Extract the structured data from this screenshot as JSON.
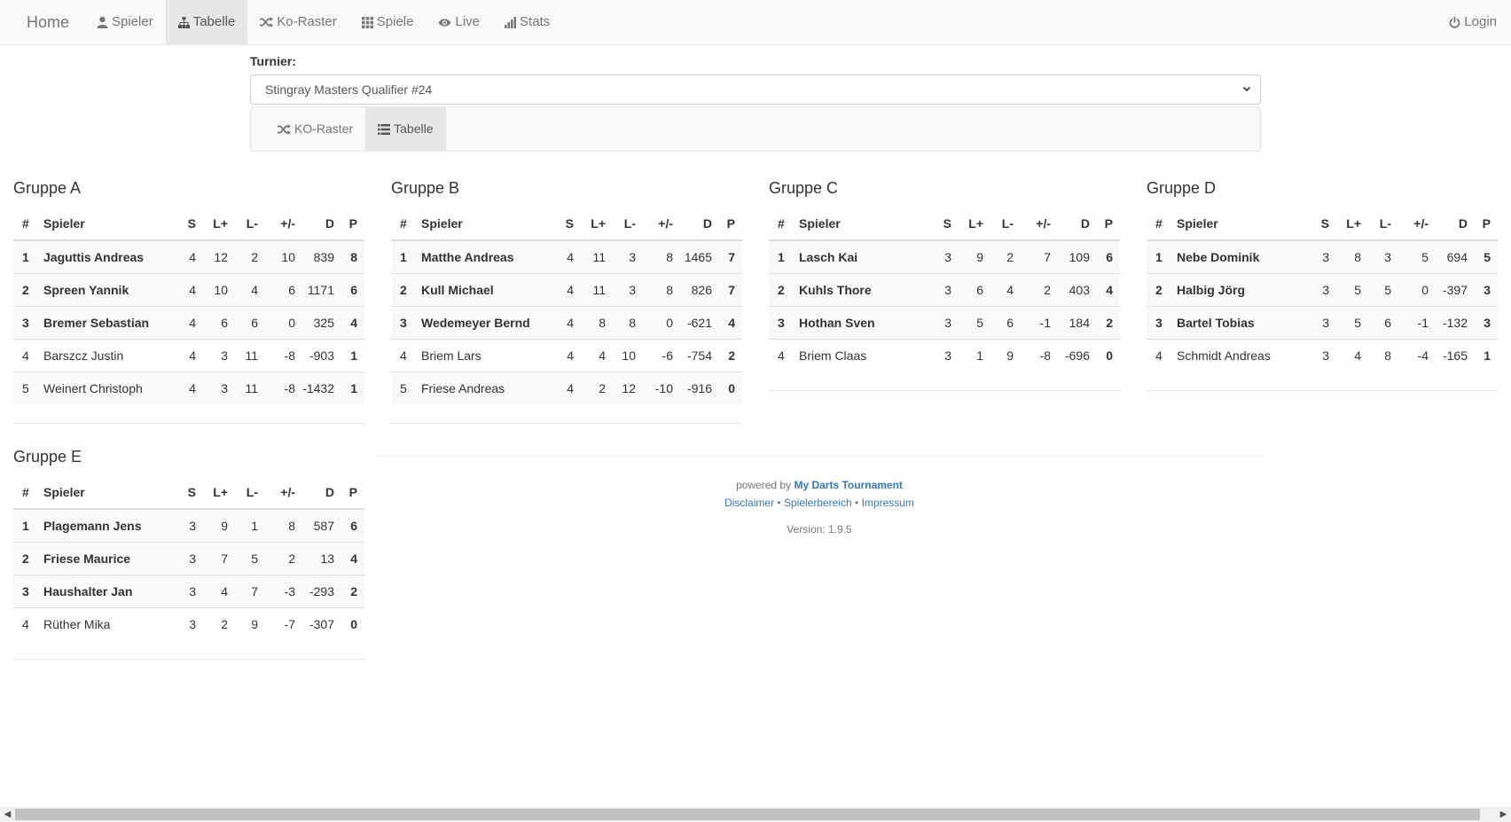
{
  "nav": {
    "brand": "Home",
    "items": [
      {
        "label": "Spieler",
        "icon": "user-icon"
      },
      {
        "label": "Tabelle",
        "icon": "tree-icon",
        "active": true
      },
      {
        "label": "Ko-Raster",
        "icon": "shuffle-icon"
      },
      {
        "label": "Spiele",
        "icon": "grid-icon"
      },
      {
        "label": "Live",
        "icon": "eye-icon"
      },
      {
        "label": "Stats",
        "icon": "bar-chart-icon"
      }
    ],
    "login": "Login"
  },
  "tournament": {
    "label": "Turnier:",
    "selected": "Stingray Masters Qualifier #24",
    "tabs": [
      {
        "label": "KO-Raster",
        "icon": "shuffle-icon"
      },
      {
        "label": "Tabelle",
        "icon": "list-icon",
        "active": true
      }
    ]
  },
  "columns": [
    "#",
    "Spieler",
    "S",
    "L+",
    "L-",
    "+/-",
    "D",
    "P"
  ],
  "groups": [
    {
      "title": "Gruppe A",
      "rows": [
        {
          "rank": "1",
          "name": "Jaguttis Andreas",
          "s": "4",
          "lp": "12",
          "lm": "2",
          "diff": "10",
          "d": "839",
          "p": "8",
          "q": true
        },
        {
          "rank": "2",
          "name": "Spreen Yannik",
          "s": "4",
          "lp": "10",
          "lm": "4",
          "diff": "6",
          "d": "1171",
          "p": "6",
          "q": true
        },
        {
          "rank": "3",
          "name": "Bremer Sebastian",
          "s": "4",
          "lp": "6",
          "lm": "6",
          "diff": "0",
          "d": "325",
          "p": "4",
          "q": true
        },
        {
          "rank": "4",
          "name": "Barszcz Justin",
          "s": "4",
          "lp": "3",
          "lm": "11",
          "diff": "-8",
          "d": "-903",
          "p": "1",
          "q": false
        },
        {
          "rank": "5",
          "name": "Weinert Christoph",
          "s": "4",
          "lp": "3",
          "lm": "11",
          "diff": "-8",
          "d": "-1432",
          "p": "1",
          "q": false
        }
      ]
    },
    {
      "title": "Gruppe B",
      "rows": [
        {
          "rank": "1",
          "name": "Matthe Andreas",
          "s": "4",
          "lp": "11",
          "lm": "3",
          "diff": "8",
          "d": "1465",
          "p": "7",
          "q": true
        },
        {
          "rank": "2",
          "name": "Kull Michael",
          "s": "4",
          "lp": "11",
          "lm": "3",
          "diff": "8",
          "d": "826",
          "p": "7",
          "q": true
        },
        {
          "rank": "3",
          "name": "Wedemeyer Bernd",
          "s": "4",
          "lp": "8",
          "lm": "8",
          "diff": "0",
          "d": "-621",
          "p": "4",
          "q": true
        },
        {
          "rank": "4",
          "name": "Briem Lars",
          "s": "4",
          "lp": "4",
          "lm": "10",
          "diff": "-6",
          "d": "-754",
          "p": "2",
          "q": false
        },
        {
          "rank": "5",
          "name": "Friese Andreas",
          "s": "4",
          "lp": "2",
          "lm": "12",
          "diff": "-10",
          "d": "-916",
          "p": "0",
          "q": false
        }
      ]
    },
    {
      "title": "Gruppe C",
      "rows": [
        {
          "rank": "1",
          "name": "Lasch Kai",
          "s": "3",
          "lp": "9",
          "lm": "2",
          "diff": "7",
          "d": "109",
          "p": "6",
          "q": true
        },
        {
          "rank": "2",
          "name": "Kuhls Thore",
          "s": "3",
          "lp": "6",
          "lm": "4",
          "diff": "2",
          "d": "403",
          "p": "4",
          "q": true
        },
        {
          "rank": "3",
          "name": "Hothan Sven",
          "s": "3",
          "lp": "5",
          "lm": "6",
          "diff": "-1",
          "d": "184",
          "p": "2",
          "q": true
        },
        {
          "rank": "4",
          "name": "Briem Claas",
          "s": "3",
          "lp": "1",
          "lm": "9",
          "diff": "-8",
          "d": "-696",
          "p": "0",
          "q": false
        }
      ]
    },
    {
      "title": "Gruppe D",
      "rows": [
        {
          "rank": "1",
          "name": "Nebe Dominik",
          "s": "3",
          "lp": "8",
          "lm": "3",
          "diff": "5",
          "d": "694",
          "p": "5",
          "q": true
        },
        {
          "rank": "2",
          "name": "Halbig Jörg",
          "s": "3",
          "lp": "5",
          "lm": "5",
          "diff": "0",
          "d": "-397",
          "p": "3",
          "q": true
        },
        {
          "rank": "3",
          "name": "Bartel Tobias",
          "s": "3",
          "lp": "5",
          "lm": "6",
          "diff": "-1",
          "d": "-132",
          "p": "3",
          "q": true
        },
        {
          "rank": "4",
          "name": "Schmidt Andreas",
          "s": "3",
          "lp": "4",
          "lm": "8",
          "diff": "-4",
          "d": "-165",
          "p": "1",
          "q": false
        }
      ]
    },
    {
      "title": "Gruppe E",
      "rows": [
        {
          "rank": "1",
          "name": "Plagemann Jens",
          "s": "3",
          "lp": "9",
          "lm": "1",
          "diff": "8",
          "d": "587",
          "p": "6",
          "q": true
        },
        {
          "rank": "2",
          "name": "Friese Maurice",
          "s": "3",
          "lp": "7",
          "lm": "5",
          "diff": "2",
          "d": "13",
          "p": "4",
          "q": true
        },
        {
          "rank": "3",
          "name": "Haushalter Jan",
          "s": "3",
          "lp": "4",
          "lm": "7",
          "diff": "-3",
          "d": "-293",
          "p": "2",
          "q": true
        },
        {
          "rank": "4",
          "name": "Rüther Mika",
          "s": "3",
          "lp": "2",
          "lm": "9",
          "diff": "-7",
          "d": "-307",
          "p": "0",
          "q": false
        }
      ]
    }
  ],
  "footer": {
    "powered_prefix": "powered by",
    "powered_link": "My Darts Tournament",
    "links": [
      "Disclaimer",
      "Spielerbereich",
      "Impressum"
    ],
    "separator": "•",
    "version": "Version: 1.9.5"
  }
}
